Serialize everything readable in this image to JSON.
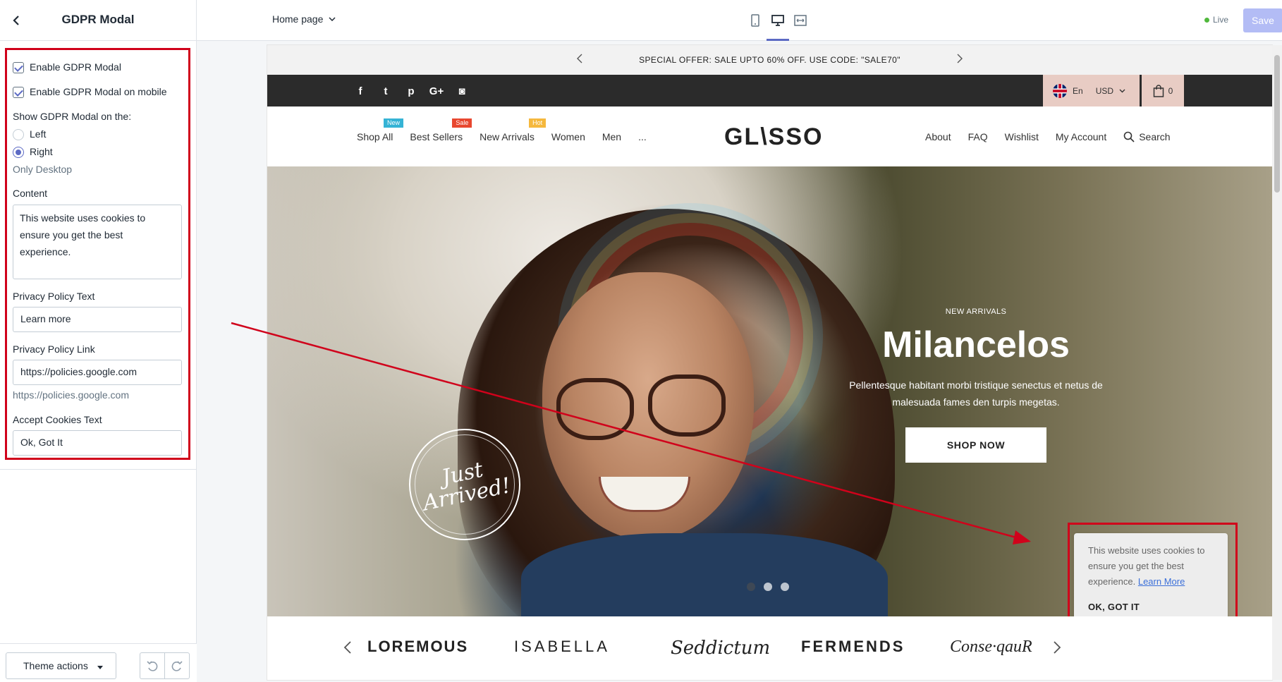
{
  "sidebar": {
    "title": "GDPR Modal",
    "enable_modal_label": "Enable GDPR Modal",
    "enable_mobile_label": "Enable GDPR Modal on mobile",
    "position_label": "Show GDPR Modal on the:",
    "position_options": [
      "Left",
      "Right"
    ],
    "position_selected": "Right",
    "position_help": "Only Desktop",
    "content_label": "Content",
    "content_value": "This website uses cookies to ensure you get the best experience.",
    "privacy_text_label": "Privacy Policy Text",
    "privacy_text_value": "Learn more",
    "privacy_link_label": "Privacy Policy Link",
    "privacy_link_value": "https://policies.google.com",
    "privacy_link_help": "https://policies.google.com",
    "accept_label": "Accept Cookies Text",
    "accept_value": "Ok, Got It",
    "theme_actions": "Theme actions"
  },
  "topbar": {
    "page": "Home page",
    "live": "Live",
    "save": "Save",
    "devices": [
      "mobile-icon",
      "desktop-icon",
      "fullwidth-icon"
    ],
    "active_device": "desktop-icon"
  },
  "store": {
    "announcement": "SPECIAL OFFER: SALE UPTO 60% OFF. USE CODE: \"SALE70\"",
    "socials": [
      "facebook-icon",
      "twitter-icon",
      "pinterest-icon",
      "google-plus-icon",
      "instagram-icon"
    ],
    "social_glyphs": [
      "f",
      "t",
      "p",
      "G+",
      "◙"
    ],
    "language": "En",
    "currency": "USD",
    "cart_count": "0",
    "nav_left": [
      {
        "label": "Shop All",
        "badge": "New",
        "badge_color": "#35b3d5"
      },
      {
        "label": "Best Sellers",
        "badge": "Sale",
        "badge_color": "#e8472f"
      },
      {
        "label": "New Arrivals",
        "badge": "Hot",
        "badge_color": "#f5b83d"
      },
      {
        "label": "Women",
        "badge": "",
        "badge_color": ""
      },
      {
        "label": "Men",
        "badge": "",
        "badge_color": ""
      },
      {
        "label": "...",
        "badge": "",
        "badge_color": ""
      }
    ],
    "logo": "GL\\SSO",
    "nav_right": [
      "About",
      "FAQ",
      "Wishlist",
      "My Account",
      "Search"
    ],
    "hero": {
      "eyebrow": "NEW ARRIVALS",
      "headline": "Milancelos",
      "subline_1": "Pellentesque habitant morbi tristique senectus et netus de",
      "subline_2": "malesuada fames den turpis megetas.",
      "button": "SHOP NOW",
      "stamp_1": "Just",
      "stamp_2": "Arrived!"
    },
    "gdpr_popup": {
      "text": "This website uses cookies to ensure you get the best experience.",
      "link": "Learn More",
      "button": "OK, GOT IT"
    },
    "brands": [
      "LOREMOUS",
      "ISABELLA",
      "Seddictum",
      "FERMENDS",
      "Conse·qauR"
    ]
  },
  "colors": {
    "accent": "#5c6ac4",
    "highlight": "#d0021b",
    "save_disabled": "#b3bcf5"
  }
}
